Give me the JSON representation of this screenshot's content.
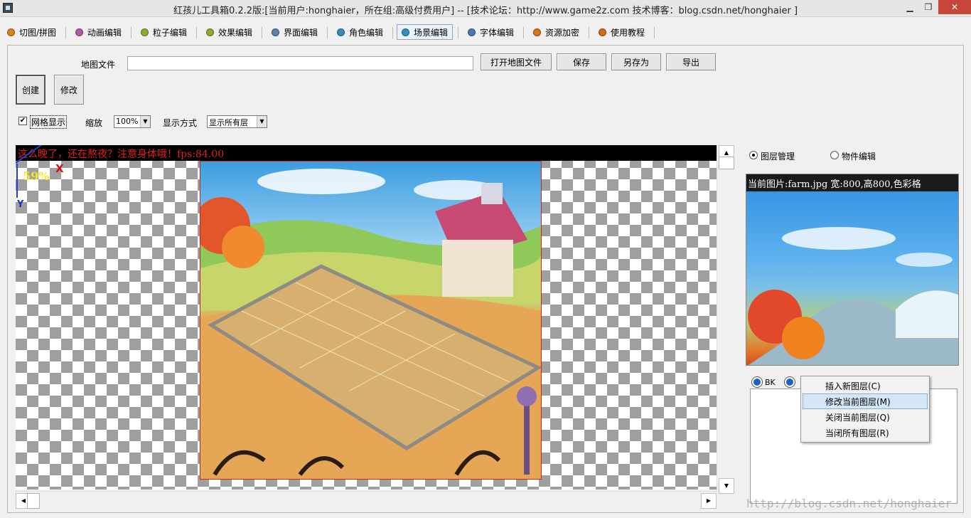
{
  "window": {
    "title": "红孩儿工具箱0.2.2版:[当前用户:honghaier，所在组:高级付费用户]  --  [技术论坛：http://www.game2z.com 技术博客：blog.csdn.net/honghaier ]",
    "minimize_glyph": "▁",
    "maximize_glyph": "❐",
    "close_glyph": "✕"
  },
  "tabs": [
    {
      "label": "切图/拼图",
      "color": "#d9831f"
    },
    {
      "label": "动画编辑",
      "color": "#b05aa8"
    },
    {
      "label": "粒子编辑",
      "color": "#8dae2c"
    },
    {
      "label": "效果编辑",
      "color": "#93a833"
    },
    {
      "label": "界面编辑",
      "color": "#5d7fa8"
    },
    {
      "label": "角色编辑",
      "color": "#3a89b8"
    },
    {
      "label": "场景编辑",
      "color": "#2f8fc0"
    },
    {
      "label": "字体编辑",
      "color": "#4d76b0"
    },
    {
      "label": "资源加密",
      "color": "#d8731c"
    },
    {
      "label": "使用教程",
      "color": "#d06a17"
    }
  ],
  "active_tab_index": 6,
  "map_file": {
    "label": "地图文件",
    "value": "",
    "open_button": "打开地图文件",
    "save_button": "保存",
    "save_as_button": "另存为",
    "export_button": "导出"
  },
  "create_button": "创建",
  "modify_button": "修改",
  "grid_toggle": {
    "label": "网格显示",
    "checked": true,
    "check_glyph": "✔"
  },
  "zoom": {
    "label": "缩放",
    "value": "100%"
  },
  "display_mode": {
    "label": "显示方式",
    "value": "显示所有层"
  },
  "viewport": {
    "status_text": "这么晚了，还在熬夜？注意身体哦！fps:84.00",
    "zoom_indicator": "59%",
    "x_axis_label": "X",
    "y_axis_label": "Y"
  },
  "scrollbar_glyphs": {
    "up": "▲",
    "down": "▼",
    "left": "◀",
    "right": "▶"
  },
  "right_panel": {
    "layer_mode_label": "图层管理",
    "object_mode_label": "物件编辑",
    "layer_mode_selected": true,
    "preview_caption": "当前图片:farm.jpg 宽:800,高800,色彩格",
    "layer_tab_label": "BK"
  },
  "context_menu": {
    "items": [
      {
        "label": "插入新图层(C)",
        "highlighted": false
      },
      {
        "label": "修改当前图层(M)",
        "highlighted": true
      },
      {
        "label": "关闭当前图层(Q)",
        "highlighted": false
      },
      {
        "label": "当闭所有图层(R)",
        "highlighted": false
      }
    ]
  },
  "watermark": "http://blog.csdn.net/honghaier"
}
